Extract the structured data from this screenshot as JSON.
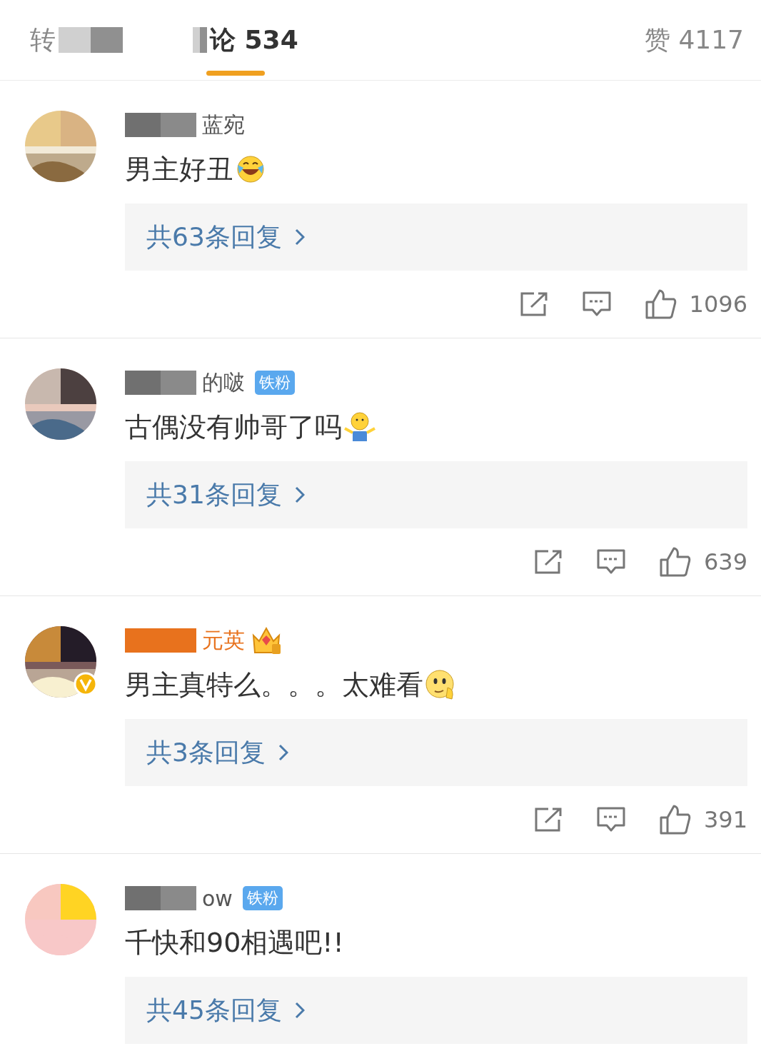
{
  "tabs": [
    {
      "label": "转",
      "selected": false,
      "redacted": true
    },
    {
      "label": "论 534",
      "selected": true,
      "redacted": true
    }
  ],
  "likes_total": "赞 4117",
  "comments": [
    {
      "user": {
        "name": "蓝宛",
        "redacted": true,
        "vip": false,
        "verified": false
      },
      "text": "男主好丑",
      "emoji": {
        "kind": "laugh-cry"
      },
      "replies": "共63条回复",
      "actions": {
        "likes": "1096"
      }
    },
    {
      "user": {
        "name": "的啵",
        "redacted": true,
        "vip": false,
        "verified": false
      },
      "badge": {
        "kind": "label",
        "text": "铁粉"
      },
      "text": "古偶没有帅哥了吗",
      "emoji": {
        "kind": "shrug"
      },
      "replies": "共31条回复",
      "actions": {
        "likes": "639"
      }
    },
    {
      "user": {
        "name": "元英",
        "redacted": true,
        "vip": true,
        "verified": true
      },
      "badge": {
        "kind": "crown"
      },
      "text": "男主真特么。。。太难看",
      "emoji": {
        "kind": "thinking"
      },
      "replies": "共3条回复",
      "actions": {
        "likes": "391"
      }
    },
    {
      "user": {
        "name": "ow",
        "redacted": true,
        "vip": false,
        "verified": false
      },
      "badge": {
        "kind": "label",
        "text": "铁粉"
      },
      "text": "千快和90相遇吧!!",
      "replies": "共45条回复"
    }
  ]
}
